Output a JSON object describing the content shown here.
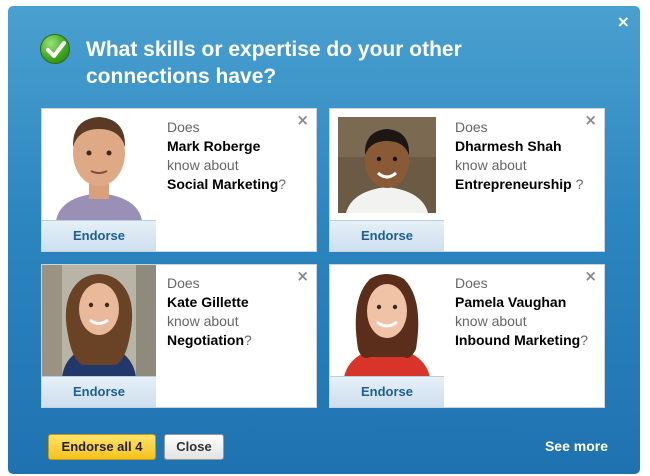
{
  "dialog": {
    "title": "What skills or expertise do your other connections have?",
    "dismiss_glyph": "×",
    "accent_color": "#2c86c0"
  },
  "cards": [
    {
      "prefix": "Does",
      "name": "Mark Roberge",
      "middle": "know about",
      "skill": "Social Marketing",
      "suffix": "?",
      "endorse_label": "Endorse",
      "close_glyph": "×"
    },
    {
      "prefix": "Does",
      "name": "Dharmesh Shah",
      "middle": "know about",
      "skill": "Entrepreneurship",
      "suffix": "?",
      "endorse_label": "Endorse",
      "close_glyph": "×"
    },
    {
      "prefix": "Does",
      "name": "Kate Gillette",
      "middle": "know about",
      "skill": "Negotiation",
      "suffix": "?",
      "endorse_label": "Endorse",
      "close_glyph": "×"
    },
    {
      "prefix": "Does",
      "name": "Pamela Vaughan",
      "middle": "know about",
      "skill": "Inbound Marketing",
      "suffix": "?",
      "endorse_label": "Endorse",
      "close_glyph": "×"
    }
  ],
  "footer": {
    "endorse_all_label": "Endorse all 4",
    "close_label": "Close",
    "see_more_label": "See more"
  },
  "icons": [
    "checkmark-icon",
    "close-icon"
  ]
}
